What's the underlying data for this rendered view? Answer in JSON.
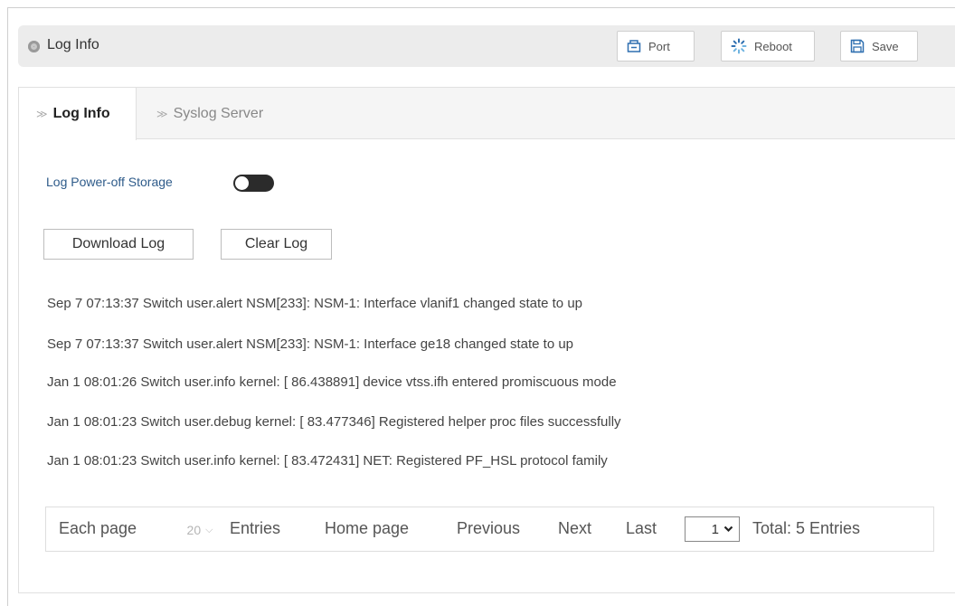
{
  "header": {
    "title": "Log Info",
    "buttons": {
      "port": "Port",
      "reboot": "Reboot",
      "save": "Save"
    }
  },
  "tabs": {
    "active": "Log Info",
    "inactive": "Syslog Server"
  },
  "storage": {
    "label": "Log Power-off Storage",
    "enabled": false
  },
  "actions": {
    "download": "Download Log",
    "clear": "Clear Log"
  },
  "logs": [
    "Sep 7 07:13:37 Switch user.alert NSM[233]: NSM-1: Interface vlanif1 changed state to up",
    "Sep 7 07:13:37 Switch user.alert NSM[233]: NSM-1: Interface ge18 changed state to up",
    "Jan 1 08:01:26 Switch user.info kernel: [ 86.438891] device vtss.ifh entered promiscuous mode",
    "Jan 1 08:01:23 Switch user.debug kernel: [ 83.477346] Registered helper proc files successfully",
    "Jan 1 08:01:23 Switch user.info kernel: [ 83.472431] NET: Registered PF_HSL protocol family"
  ],
  "pager": {
    "each_page": "Each page",
    "page_size": "20",
    "entries": "Entries",
    "home": "Home page",
    "previous": "Previous",
    "next": "Next",
    "last": "Last",
    "current_page": "1",
    "total": "Total: 5 Entries"
  },
  "colors": {
    "accent_blue": "#2e6fb0",
    "link_label": "#2e5b8a",
    "titlebar_bg": "#ececec",
    "toggle_bg": "#2b2b2b"
  }
}
